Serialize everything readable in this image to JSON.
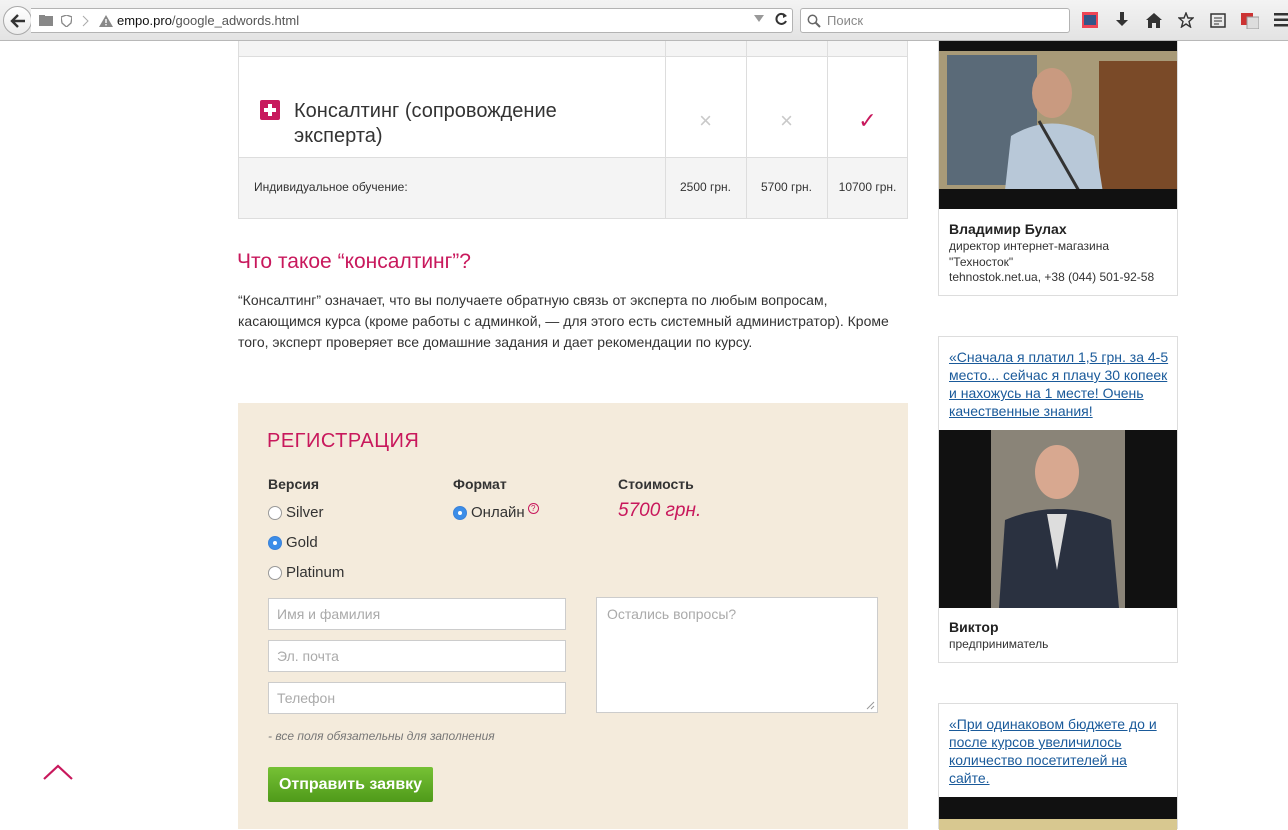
{
  "browser": {
    "url_prefix": "empo.pro",
    "url_path": "/google_adwords.html",
    "search_placeholder": "Поиск"
  },
  "comparison": {
    "feature": "Консалтинг (сопровождение эксперта)",
    "marks": [
      "×",
      "×",
      "✓"
    ],
    "row_label": "Индивидуальное обучение:",
    "prices": [
      "2500 грн.",
      "5700 грн.",
      "10700 грн."
    ]
  },
  "consulting": {
    "title": "Что такое “консалтинг”?",
    "text": "“Консалтинг” означает, что вы получаете обратную связь от эксперта по любым вопросам, касающимся курса (кроме работы с админкой, — для этого есть системный администратор). Кроме того, эксперт проверяет все домашние задания и дает рекомендации по курсу."
  },
  "registration": {
    "title": "РЕГИСТРАЦИЯ",
    "version_label": "Версия",
    "format_label": "Формат",
    "cost_label": "Стоимость",
    "versions": [
      {
        "label": "Silver",
        "selected": false
      },
      {
        "label": "Gold",
        "selected": true
      },
      {
        "label": "Platinum",
        "selected": false
      }
    ],
    "format_option": "Онлайн",
    "help_mark": "?",
    "price": "5700 грн.",
    "name_placeholder": "Имя и фамилия",
    "email_placeholder": "Эл. почта",
    "phone_placeholder": "Телефон",
    "questions_placeholder": "Остались вопросы?",
    "note": "- все поля обязательны для заполнения",
    "submit_label": "Отправить заявку"
  },
  "sidebar": {
    "testimonial1": {
      "name": "Владимир Булах",
      "role_line1": "директор интернет-магазина",
      "role_line2": "\"Техносток\"",
      "role_line3": "tehnostok.net.ua, +38 (044) 501-92-58"
    },
    "testimonial2": {
      "quote": "«Сначала я платил 1,5 грн. за 4-5 место... сейчас я плачу 30 копеек и нахожусь на 1 месте! Очень качественные знания!",
      "name": "Виктор",
      "role": "предприниматель"
    },
    "testimonial3": {
      "quote": "«При одинаковом бюджете до и после курсов увеличилось количество посетителей на сайте."
    }
  },
  "colors": {
    "accent": "#c8185c",
    "registration_bg": "#f4ebdc",
    "submit_green": "#5fac22",
    "link_blue": "#1a5a9a"
  }
}
